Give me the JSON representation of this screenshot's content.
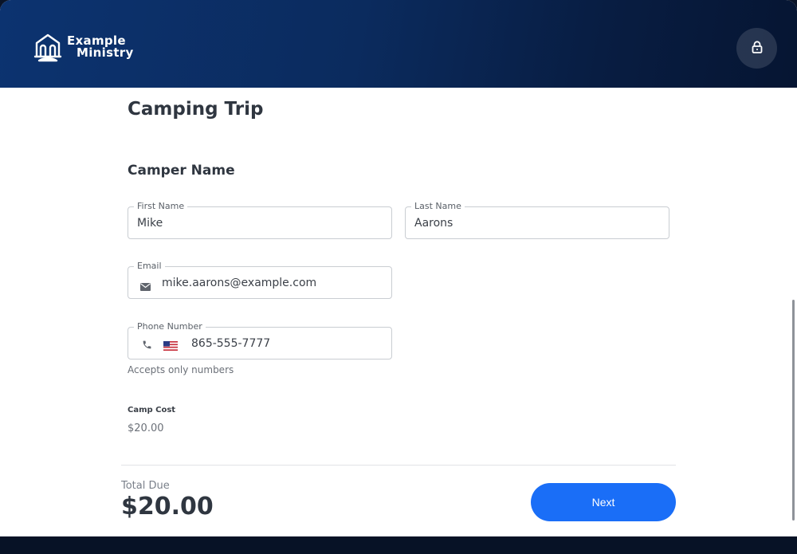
{
  "header": {
    "logo_line1": "Example",
    "logo_line2": "Ministry",
    "logo_icon": "church-icon",
    "lock_icon": "lock-icon",
    "gradient_start": "#0c3370",
    "gradient_end": "#061532"
  },
  "page": {
    "title": "Camping Trip",
    "section_title": "Camper Name"
  },
  "form": {
    "first_name": {
      "label": "First Name",
      "value": "Mike"
    },
    "last_name": {
      "label": "Last Name",
      "value": "Aarons"
    },
    "email": {
      "label": "Email",
      "value": "mike.aarons@example.com",
      "icon": "envelope-icon"
    },
    "phone": {
      "label": "Phone Number",
      "value": "865-555-7777",
      "icon": "phone-icon",
      "country_flag": "us-flag-icon",
      "helper": "Accepts only numbers"
    }
  },
  "cost": {
    "label": "Camp Cost",
    "value": "$20.00"
  },
  "summary": {
    "total_label": "Total Due",
    "total_value": "$20.00",
    "next_label": "Next",
    "accent": "#1a6ef7"
  }
}
